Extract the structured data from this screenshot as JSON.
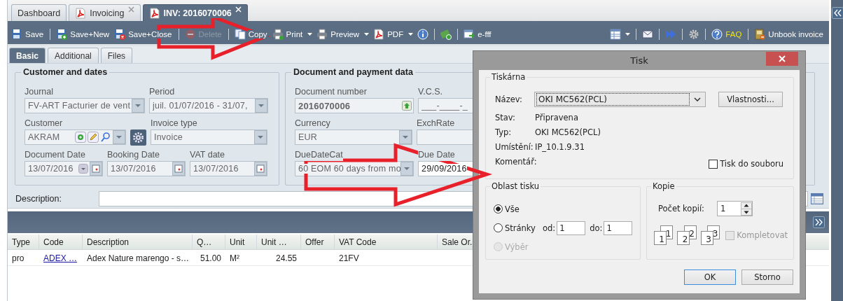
{
  "tabs": [
    {
      "label": "Dashboard",
      "has_icon": false,
      "closable": false,
      "selected": false
    },
    {
      "label": "Invoicing",
      "has_icon": true,
      "closable": true,
      "selected": false
    },
    {
      "label": "INV: 2016070006",
      "has_icon": true,
      "closable": true,
      "selected": true
    }
  ],
  "toolbar": {
    "left": [
      {
        "kind": "button",
        "label": "Save",
        "disabled": false,
        "dropdown": false,
        "highlighted": false
      },
      {
        "kind": "separator"
      },
      {
        "kind": "button",
        "label": "Save+New",
        "disabled": false,
        "dropdown": false,
        "highlighted": false
      },
      {
        "kind": "button",
        "label": "Save+Close",
        "disabled": false,
        "dropdown": false,
        "highlighted": false
      },
      {
        "kind": "separator"
      },
      {
        "kind": "button",
        "label": "Delete",
        "disabled": true,
        "dropdown": false,
        "highlighted": false
      },
      {
        "kind": "separator"
      },
      {
        "kind": "button",
        "label": "Copy",
        "disabled": false,
        "dropdown": false,
        "highlighted": false
      },
      {
        "kind": "button",
        "label": "Print",
        "disabled": false,
        "dropdown": true,
        "highlighted": false
      },
      {
        "kind": "button",
        "label": "Preview",
        "disabled": false,
        "dropdown": true,
        "highlighted": false
      },
      {
        "kind": "button",
        "label": "PDF",
        "disabled": false,
        "dropdown": true,
        "highlighted": false
      },
      {
        "kind": "icon",
        "disabled": false,
        "dropdown": false
      },
      {
        "kind": "separator"
      },
      {
        "kind": "icon",
        "disabled": false,
        "dropdown": false
      },
      {
        "kind": "separator"
      },
      {
        "kind": "button",
        "label": "e-fff",
        "disabled": false,
        "dropdown": false,
        "highlighted": false
      }
    ],
    "right": [
      {
        "kind": "icon",
        "disabled": false,
        "dropdown": true
      },
      {
        "kind": "separator"
      },
      {
        "kind": "icon",
        "disabled": false,
        "dropdown": false
      },
      {
        "kind": "separator"
      },
      {
        "kind": "icon",
        "disabled": false,
        "dropdown": false
      },
      {
        "kind": "separator"
      },
      {
        "kind": "icon",
        "disabled": false,
        "dropdown": false
      },
      {
        "kind": "separator"
      },
      {
        "kind": "button",
        "label": "FAQ",
        "disabled": false,
        "dropdown": false,
        "highlighted": true
      },
      {
        "kind": "separator"
      },
      {
        "kind": "button",
        "label": "Unbook invoice",
        "disabled": false,
        "dropdown": false,
        "highlighted": false
      }
    ]
  },
  "subtabs": [
    {
      "label": "Basic",
      "selected": true
    },
    {
      "label": "Additional",
      "selected": false
    },
    {
      "label": "Files",
      "selected": false
    }
  ],
  "fieldsets": [
    {
      "title": "Customer and dates",
      "rows": [
        [
          {
            "label": "Journal",
            "value": "FV-ART Facturier de vent",
            "kind": "combo",
            "disabled": true
          },
          {
            "label": "Period",
            "value": "juil. 01/07/2016 - 31/07,",
            "kind": "combo",
            "disabled": true
          }
        ],
        [
          {
            "label": "Customer",
            "value": "AKRAM",
            "kind": "lookup",
            "disabled": true
          },
          {
            "kind": "gear"
          },
          {
            "label": "Invoice type",
            "value": "Invoice",
            "kind": "combo",
            "disabled": true
          }
        ],
        [
          {
            "label": "Document Date",
            "value": "13/07/2016",
            "kind": "date-combo",
            "disabled": true
          },
          {
            "label": "Booking Date",
            "value": "13/07/2016",
            "kind": "date",
            "disabled": true
          },
          {
            "label": "VAT date",
            "value": "13/07/2016",
            "kind": "date",
            "disabled": true
          }
        ]
      ]
    },
    {
      "title": "Document and payment data",
      "rows": [
        [
          {
            "label": "Document number",
            "value": "2016070006",
            "kind": "number",
            "disabled": true
          },
          {
            "label": "V.C.S.",
            "value": "___-____-_",
            "kind": "text",
            "disabled": true
          }
        ],
        [
          {
            "label": "Currency",
            "value": "EUR",
            "kind": "combo",
            "disabled": true
          },
          {
            "label": "ExchRate",
            "kind": "text",
            "disabled": true
          }
        ],
        [
          {
            "label": "DueDateCat",
            "value": "60 EOM 60 days from mo",
            "kind": "combo",
            "disabled": true
          },
          {
            "label": "Due Date",
            "value": "29/09/2016",
            "kind": "text",
            "disabled": false
          }
        ]
      ]
    }
  ],
  "description_label": "Description:",
  "grid": {
    "columns": [
      {
        "label": "Type",
        "kind": "text"
      },
      {
        "label": "Code",
        "kind": "link"
      },
      {
        "label": "Description",
        "kind": "text"
      },
      {
        "label": "Q…",
        "kind": "number"
      },
      {
        "label": "Unit",
        "kind": "text"
      },
      {
        "label": "Unit …",
        "kind": "number"
      },
      {
        "label": "Offer",
        "kind": "text"
      },
      {
        "label": "VAT Code",
        "kind": "text"
      },
      {
        "label": "Sale Or.",
        "kind": "text"
      }
    ],
    "rows": [
      {
        "cells": [
          "pro",
          "ADEX …",
          "Adex Nature marengo - s…",
          "51.00",
          "M²",
          "24.55",
          null,
          "21FV",
          null
        ]
      }
    ]
  },
  "print_dialog": {
    "title": "Tisk",
    "printer_group": "Tiskárna",
    "name_label": "Název:",
    "printer": "OKI MC562(PCL)",
    "properties_button": "Vlastnosti...",
    "info": [
      {
        "label": "Stav:",
        "value": "Připravena"
      },
      {
        "label": "Typ:",
        "value": "OKI MC562(PCL)"
      },
      {
        "label": "Umístění:",
        "value": "IP_10.1.9.31"
      },
      {
        "label": "Komentář:"
      }
    ],
    "print_to_file": {
      "label": "Tisk do souboru",
      "checked": false
    },
    "range_group": "Oblast tisku",
    "range_options": [
      {
        "label": "Vše",
        "selected": true,
        "disabled": false
      },
      {
        "label": "Stránky",
        "selected": false,
        "disabled": false
      },
      {
        "label": "Výběr",
        "selected": false,
        "disabled": true
      }
    ],
    "from_label": "od:",
    "from": "1",
    "to_label": "do:",
    "to": "1",
    "copies_group": "Kopie",
    "copies_label": "Počet kopií:",
    "copies": "1",
    "collate_pages": [
      {
        "back": "1",
        "front": "1"
      },
      {
        "back": "2",
        "front": "2"
      },
      {
        "back": "3",
        "front": "3"
      }
    ],
    "collate": {
      "label": "Kompletovat",
      "checked": false,
      "disabled": true
    },
    "buttons": [
      {
        "label": "OK",
        "default": true
      },
      {
        "label": "Storno",
        "default": false
      }
    ]
  }
}
